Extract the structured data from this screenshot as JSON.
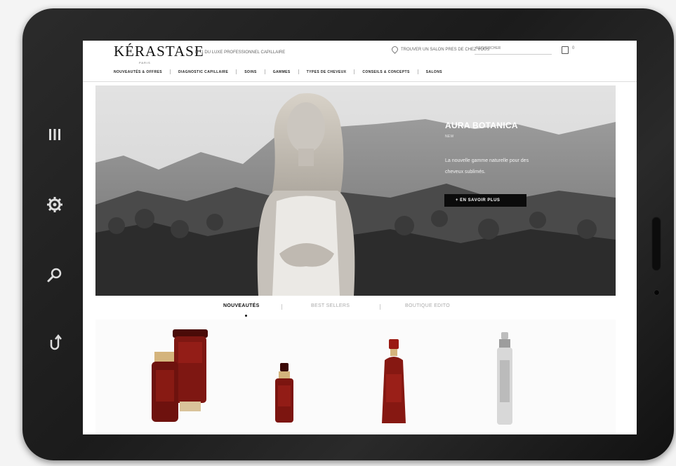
{
  "device": {
    "side_buttons": [
      {
        "icon": "menu-icon",
        "label": "III"
      },
      {
        "icon": "gear-icon"
      },
      {
        "icon": "magnifier-icon"
      },
      {
        "icon": "back-arrow-icon"
      }
    ]
  },
  "header": {
    "logo": "KÉRASTASE",
    "logo_sub": "PARIS",
    "tagline": "N° 1 DU LUXE PROFESSIONNEL CAPILLAIRE",
    "store_label": "TROUVER UN SALON PRES DE CHEZ VOUS",
    "search_placeholder": "RECHERCHER",
    "bag_count": "0"
  },
  "nav": [
    "NOUVEAUTÉS & OFFRES",
    "DIAGNOSTIC CAPILLAIRE",
    "SOINS",
    "GAMMES",
    "TYPES DE CHEVEUX",
    "CONSEILS & CONCEPTS",
    "SALONS"
  ],
  "hero": {
    "title": "AURA BOTANICA",
    "subtitle": "NEW",
    "description": "La nouvelle gamme naturelle pour des cheveux sublimés.",
    "cta": "+ EN SAVOIR PLUS"
  },
  "tabs": [
    {
      "label": "NOUVEAUTÉS",
      "active": true
    },
    {
      "label": "BEST SELLERS",
      "active": false
    },
    {
      "label": "BOUTIQUE EDITO",
      "active": false
    }
  ],
  "products": [
    {
      "name": "elixir-ultime-duo",
      "color": "#7e1712"
    },
    {
      "name": "elixir-ultime-serum",
      "color": "#7c1510"
    },
    {
      "name": "elixir-ultime-oil",
      "color": "#861812"
    },
    {
      "name": "silver-spray",
      "color": "#cfcfcf"
    }
  ],
  "colors": {
    "device": "#1b1b1b",
    "cta_background": "#0b0b0b",
    "bottle_red": "#7e1712"
  }
}
